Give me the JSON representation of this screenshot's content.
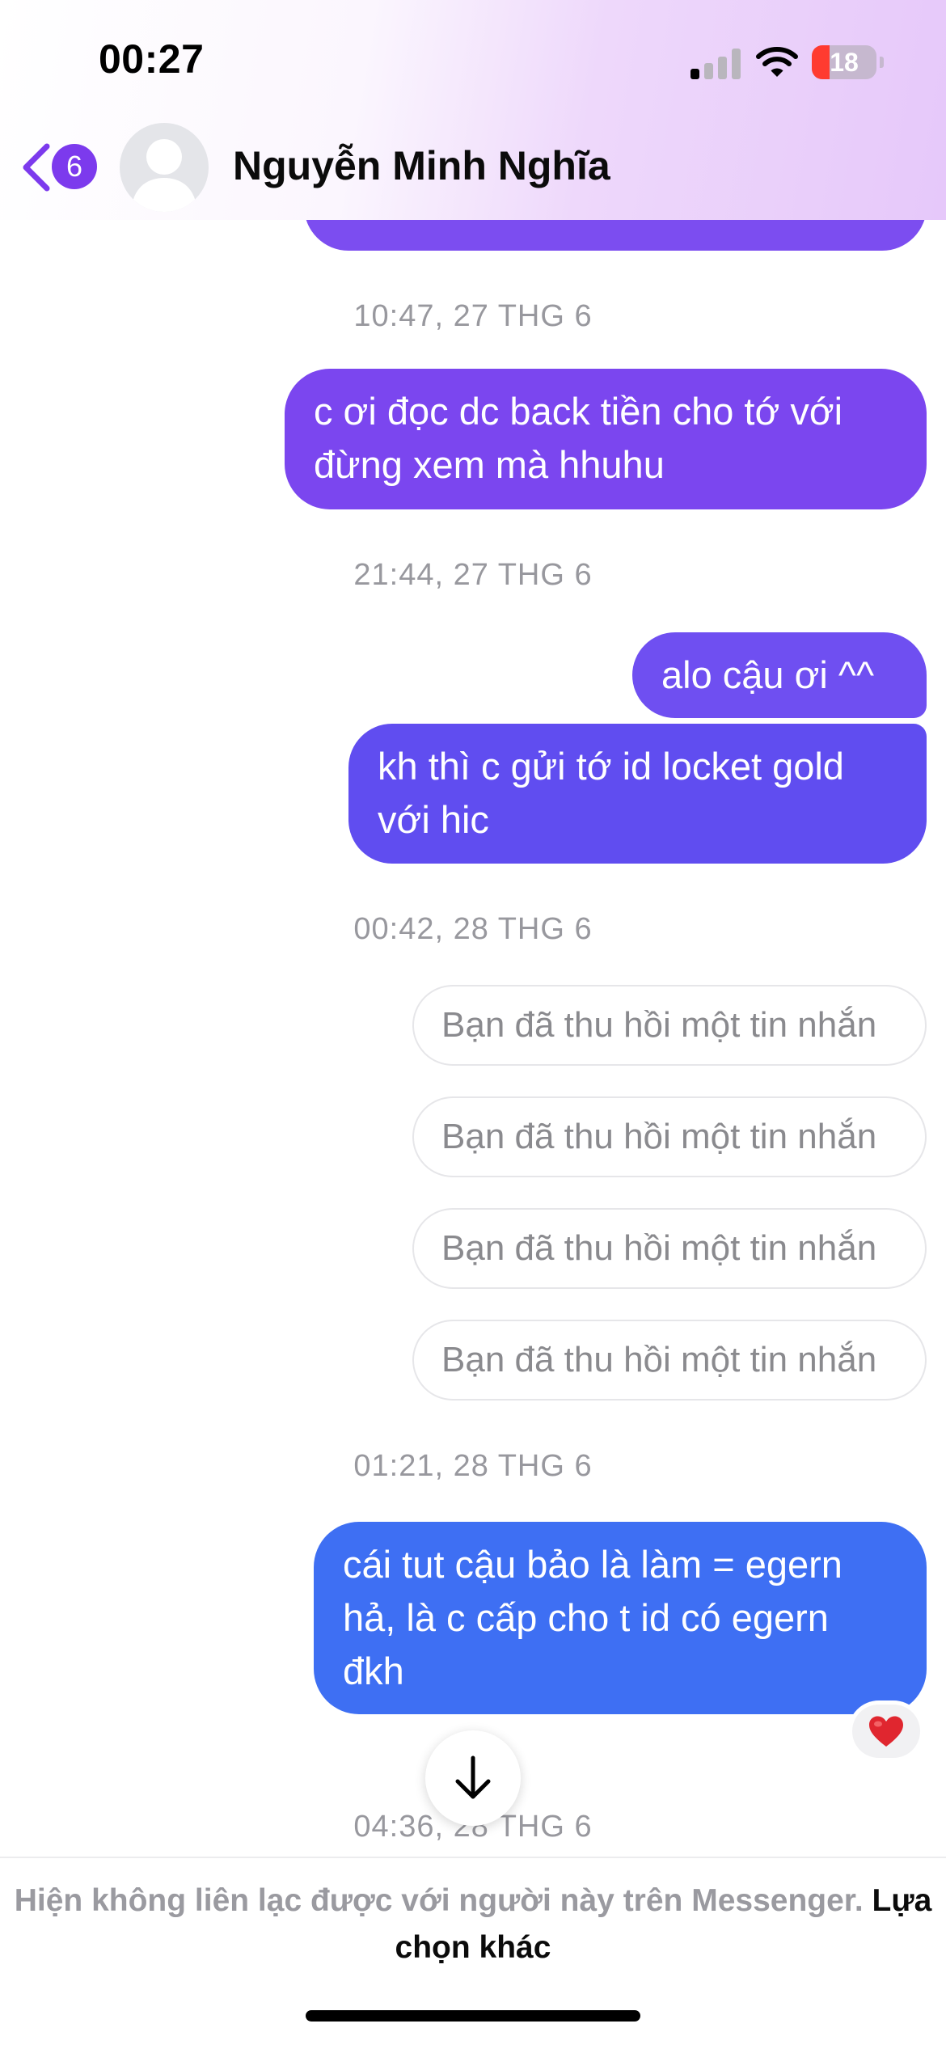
{
  "status_bar": {
    "time": "00:27",
    "battery": "18"
  },
  "header": {
    "unread_count": "6",
    "contact_name": "Nguyễn Minh Nghĩa"
  },
  "messages": [
    {
      "type": "timestamp",
      "text": "10:47, 27 THG 6"
    },
    {
      "type": "sent",
      "text": "c ơi đọc dc back tiền cho tớ với đừng xem mà hhuhu"
    },
    {
      "type": "timestamp",
      "text": "21:44, 27 THG 6"
    },
    {
      "type": "sent",
      "text": "alo cậu ơi ^^"
    },
    {
      "type": "sent",
      "text": "kh thì c gửi tớ id locket gold với hic"
    },
    {
      "type": "timestamp",
      "text": "00:42, 28 THG 6"
    },
    {
      "type": "recalled",
      "text": "Bạn đã thu hồi một tin nhắn"
    },
    {
      "type": "recalled",
      "text": "Bạn đã thu hồi một tin nhắn"
    },
    {
      "type": "recalled",
      "text": "Bạn đã thu hồi một tin nhắn"
    },
    {
      "type": "recalled",
      "text": "Bạn đã thu hồi một tin nhắn"
    },
    {
      "type": "timestamp",
      "text": "01:21, 28 THG 6"
    },
    {
      "type": "sent",
      "text": "cái tut cậu bảo là làm = egern hả, là c cấp cho t id có egern đkh",
      "reaction": "heart"
    },
    {
      "type": "timestamp",
      "text": "04:36, 28 THG 6"
    }
  ],
  "footer": {
    "notice": "Hiện không liên lạc được với người này trên Messenger.",
    "link": "Lựa chọn khác"
  },
  "colors": {
    "bubble_violet": "#7b46ef",
    "bubble_indigo": "#604df0",
    "bubble_blue": "#3e6ff3",
    "accent": "#7c3aed"
  },
  "icons": [
    "back-chevron-icon",
    "avatar-placeholder-icon",
    "heart-reaction-icon",
    "arrow-down-icon",
    "signal-icon",
    "wifi-icon",
    "battery-icon"
  ]
}
